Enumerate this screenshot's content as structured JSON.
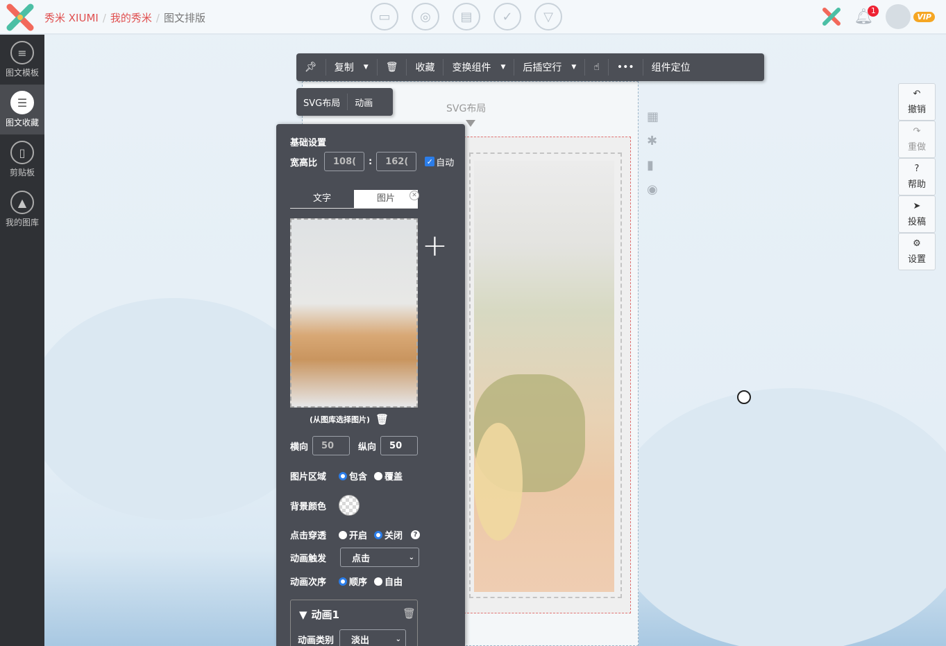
{
  "brand": {
    "colors": {
      "accent": "#e05050",
      "panel": "#4a4d55",
      "sidebar": "#2f3135"
    }
  },
  "breadcrumb": {
    "items": [
      "秀米 XIUMI",
      "我的秀米",
      "图文排版"
    ],
    "separator": "/"
  },
  "header": {
    "notification_count": "1",
    "vip_label": "VIP"
  },
  "sidebar": {
    "items": [
      {
        "label": "图文模板",
        "icon": "list-icon"
      },
      {
        "label": "图文收藏",
        "icon": "favorite-icon"
      },
      {
        "label": "剪贴板",
        "icon": "clipboard-icon"
      },
      {
        "label": "我的图库",
        "icon": "gallery-icon"
      }
    ]
  },
  "toolbar": {
    "copy": "复制",
    "collect": "收藏",
    "transform": "变换组件",
    "insert_after": "后插空行",
    "more": "•••",
    "locate": "组件定位"
  },
  "subtoolbar": {
    "svg_layout": "SVG布局",
    "animation": "动画"
  },
  "canvas": {
    "svg_label": "SVG布局"
  },
  "rightpanel": {
    "undo": "撤销",
    "redo": "重做",
    "help": "帮助",
    "submit": "投稿",
    "settings": "设置"
  },
  "settings": {
    "title": "基础设置",
    "ratio_label": "宽高比",
    "ratio_w": "108(",
    "ratio_sep": ":",
    "ratio_h": "162(",
    "auto_label": "自动",
    "tab_text": "文字",
    "tab_image": "图片",
    "pick_text": "(从图库选择图片)",
    "h_label": "横向",
    "h_value": "50",
    "v_label": "纵向",
    "v_value": "50",
    "area_label": "图片区域",
    "area_opt1": "包含",
    "area_opt2": "覆盖",
    "bg_label": "背景颜色",
    "click_label": "点击穿透",
    "click_opt1": "开启",
    "click_opt2": "关闭",
    "trigger_label": "动画触发",
    "trigger_value": "点击",
    "order_label": "动画次序",
    "order_opt1": "顺序",
    "order_opt2": "自由",
    "anim_title": "动画1",
    "anim_type_label": "动画类别",
    "anim_type_value": "淡出"
  }
}
